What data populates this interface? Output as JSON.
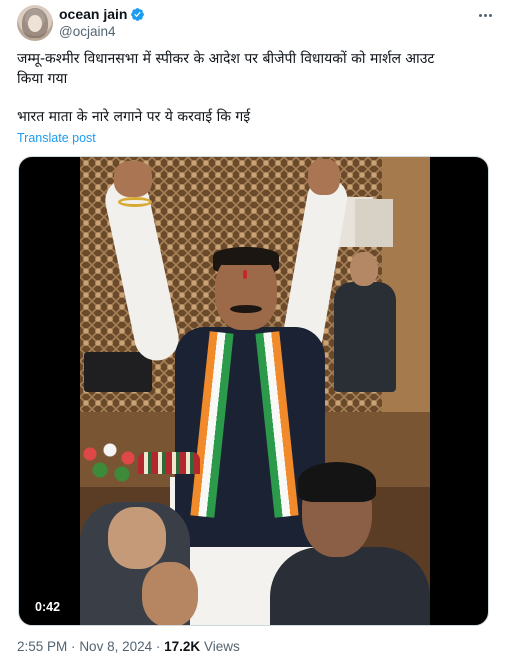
{
  "author": {
    "display_name": "ocean jain",
    "handle": "@ocjain4",
    "verified_badge": "verified-check-icon",
    "accent_color": "#1d9bf0"
  },
  "post": {
    "line1": "जम्मू-कश्मीर विधानसभा में स्पीकर के आदेश पर बीजेपी विधायकों को मार्शल आउट",
    "line2": "किया गया",
    "line3": "भारत माता के नारे लगाने पर ये करवाई कि गई",
    "translate_label": "Translate post"
  },
  "media": {
    "type": "video",
    "duration": "0:42"
  },
  "footer": {
    "time": "2:55 PM",
    "separator": "·",
    "date": "Nov 8, 2024",
    "views_count": "17.2K",
    "views_label": "Views"
  },
  "menu_icon": "more-options-icon"
}
